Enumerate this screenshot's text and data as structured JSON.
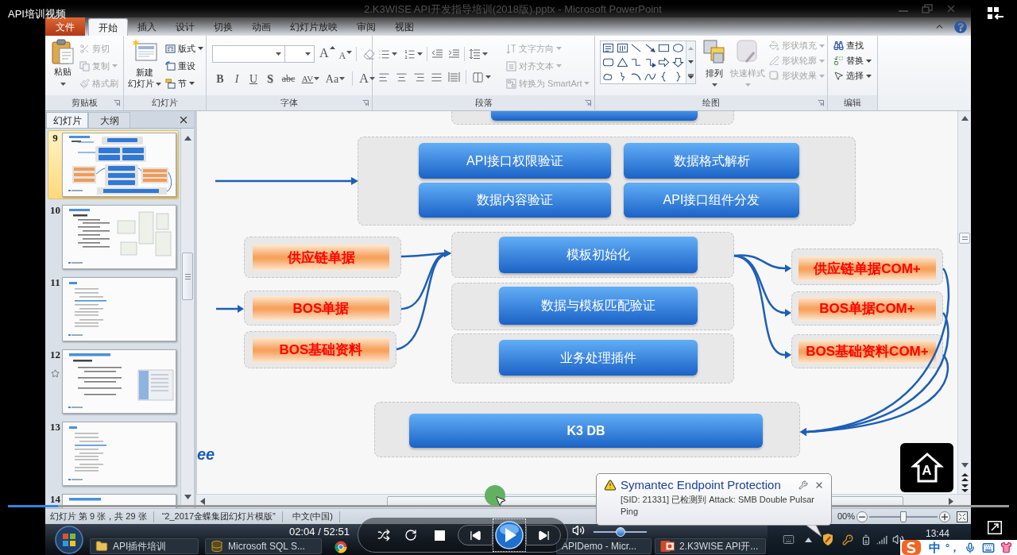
{
  "player": {
    "title": "API培训视频",
    "time": "02:04 / 52:51",
    "playing": false,
    "progress": {
      "level": 0.05
    },
    "volume": {
      "level": 0.5
    }
  },
  "window": {
    "title": "2.K3WISE API开发指导培训(2018版).pptx - Microsoft PowerPoint"
  },
  "ribbon": {
    "tabs": [
      {
        "label": "文件",
        "kind": "file",
        "selected": false
      },
      {
        "label": "开始",
        "kind": "tab",
        "selected": true
      },
      {
        "label": "插入",
        "kind": "tab",
        "selected": false
      },
      {
        "label": "设计",
        "kind": "tab",
        "selected": false
      },
      {
        "label": "切换",
        "kind": "tab",
        "selected": false
      },
      {
        "label": "动画",
        "kind": "tab",
        "selected": false
      },
      {
        "label": "幻灯片放映",
        "kind": "tab",
        "selected": false
      },
      {
        "label": "审阅",
        "kind": "tab",
        "selected": false
      },
      {
        "label": "视图",
        "kind": "tab",
        "selected": false
      }
    ],
    "groups": [
      {
        "kind": "clipboard",
        "label": "剪贴板",
        "large": [
          {
            "label": "粘贴",
            "disabled": false
          }
        ],
        "small": [
          {
            "label": "剪切",
            "disabled": true
          },
          {
            "label": "复制",
            "disabled": true
          },
          {
            "label": "格式刷",
            "disabled": true
          }
        ]
      },
      {
        "kind": "slides",
        "label": "幻灯片",
        "large": [
          {
            "lines": [
              "新建",
              "幻灯片"
            ],
            "disabled": false
          }
        ],
        "small": [
          {
            "label": "版式",
            "disabled": false
          },
          {
            "label": "重设",
            "disabled": false
          },
          {
            "label": "节",
            "disabled": false
          }
        ]
      },
      {
        "kind": "font",
        "label": "字体",
        "size_buttons": [
          "A",
          "A"
        ],
        "format_buttons": [
          "B",
          "I",
          "U",
          "S",
          "abc",
          "AV",
          "Aa",
          "A"
        ]
      },
      {
        "kind": "paragraph",
        "label": "段落",
        "small": [
          {
            "label": "文字方向",
            "disabled": true
          },
          {
            "label": "对齐文本",
            "disabled": true
          },
          {
            "label": "转换为 SmartArt",
            "disabled": true
          }
        ]
      },
      {
        "kind": "drawing",
        "label": "绘图",
        "large": [
          {
            "label": "排列",
            "disabled": false
          },
          {
            "label": "快速样式",
            "disabled": true
          }
        ],
        "small": [
          {
            "label": "形状填充",
            "disabled": true
          },
          {
            "label": "形状轮廓",
            "disabled": true
          },
          {
            "label": "形状效果",
            "disabled": true
          }
        ]
      },
      {
        "kind": "editing",
        "label": "编辑",
        "small": [
          {
            "label": "查找",
            "disabled": false
          },
          {
            "label": "替换",
            "disabled": false
          },
          {
            "label": "选择",
            "disabled": false
          }
        ]
      }
    ]
  },
  "slides_pane": {
    "tabs": [
      {
        "label": "幻灯片",
        "selected": true
      },
      {
        "label": "大纲",
        "selected": false
      }
    ],
    "thumbnails": [
      {
        "number": "9",
        "kind": "diagram",
        "selected": true,
        "animated": false
      },
      {
        "number": "10",
        "kind": "tables",
        "selected": false,
        "animated": false
      },
      {
        "number": "11",
        "kind": "contents",
        "selected": false,
        "animated": false
      },
      {
        "number": "12",
        "kind": "screenshot",
        "selected": false,
        "animated": true
      },
      {
        "number": "13",
        "kind": "contents",
        "selected": false,
        "animated": false
      },
      {
        "number": "14",
        "kind": "title",
        "selected": false,
        "animated": false
      }
    ]
  },
  "slide": {
    "validation": [
      "API接口权限验证",
      "数据格式解析",
      "数据内容验证",
      "API接口组件分发"
    ],
    "sources": [
      "供应链单据",
      "BOS单据",
      "BOS基础资料"
    ],
    "steps": [
      "模板初始化",
      "数据与模板匹配验证",
      "业务处理插件"
    ],
    "targets": [
      "供应链单据COM+",
      "BOS单据COM+",
      "BOS基础资料COM+"
    ],
    "database": "K3 DB",
    "logo_fragment": "ee"
  },
  "floating_button": {
    "label": "A"
  },
  "status_bar": {
    "slide_info": "幻灯片 第 9 张，共 29 张",
    "theme": "“2_2017金蝶集团幻灯片模版”",
    "language": "中文(中国)",
    "zoom": "00%",
    "zoom_slider": {
      "level": 0.5
    }
  },
  "notification": {
    "title": "Symantec Endpoint Protection",
    "message": "[SID: 21331] 已检测到 Attack: SMB Double Pulsar Ping"
  },
  "taskbar": {
    "items": [
      {
        "kind": "folder",
        "label": "API插件培训"
      },
      {
        "kind": "database",
        "label": "Microsoft SQL S..."
      },
      {
        "kind": "window",
        "label": "APIDemo - Micr..."
      },
      {
        "kind": "presentation",
        "label": "2.K3WISE API开..."
      }
    ],
    "clock": "13:44"
  },
  "ime": {
    "mode": "中",
    "punctuation": "°，"
  }
}
